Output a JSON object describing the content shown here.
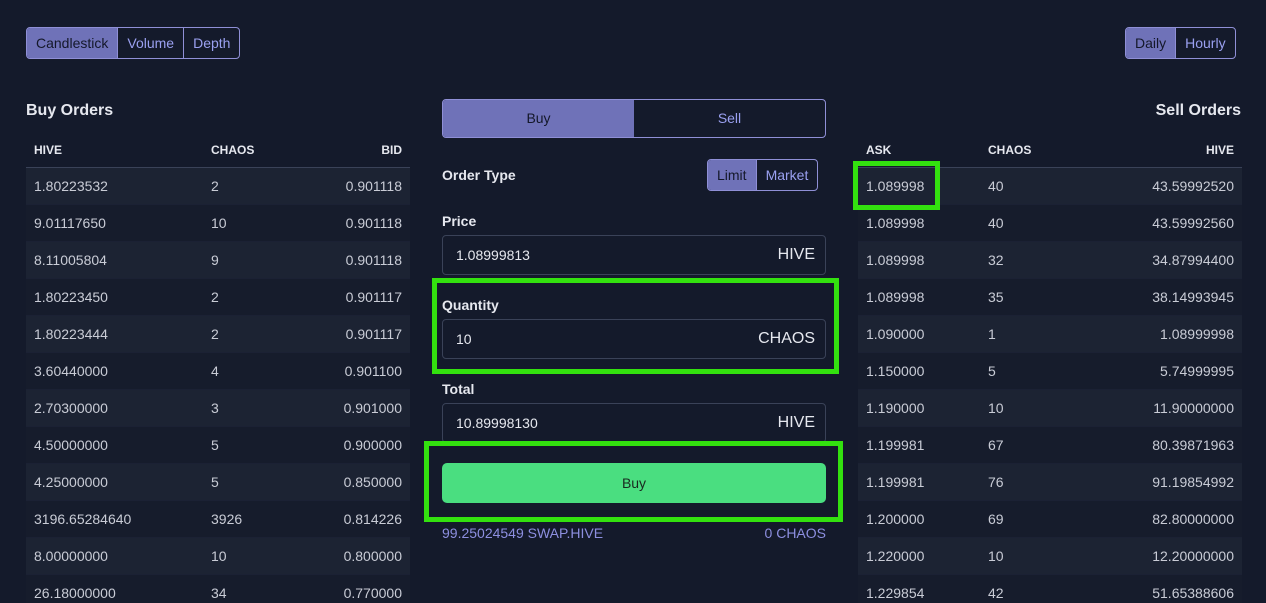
{
  "chart_toggle": {
    "candlestick": "Candlestick",
    "volume": "Volume",
    "depth": "Depth",
    "active": "Candlestick"
  },
  "interval_toggle": {
    "daily": "Daily",
    "hourly": "Hourly",
    "active": "Daily"
  },
  "buy_orders": {
    "title": "Buy Orders",
    "columns": [
      "HIVE",
      "CHAOS",
      "BID"
    ],
    "rows": [
      [
        "1.80223532",
        "2",
        "0.901118"
      ],
      [
        "9.01117650",
        "10",
        "0.901118"
      ],
      [
        "8.11005804",
        "9",
        "0.901118"
      ],
      [
        "1.80223450",
        "2",
        "0.901117"
      ],
      [
        "1.80223444",
        "2",
        "0.901117"
      ],
      [
        "3.60440000",
        "4",
        "0.901100"
      ],
      [
        "2.70300000",
        "3",
        "0.901000"
      ],
      [
        "4.50000000",
        "5",
        "0.900000"
      ],
      [
        "4.25000000",
        "5",
        "0.850000"
      ],
      [
        "3196.65284640",
        "3926",
        "0.814226"
      ],
      [
        "8.00000000",
        "10",
        "0.800000"
      ],
      [
        "26.18000000",
        "34",
        "0.770000"
      ]
    ]
  },
  "sell_orders": {
    "title": "Sell Orders",
    "columns": [
      "ASK",
      "CHAOS",
      "HIVE"
    ],
    "rows": [
      [
        "1.089998",
        "40",
        "43.59992520"
      ],
      [
        "1.089998",
        "40",
        "43.59992560"
      ],
      [
        "1.089998",
        "32",
        "34.87994400"
      ],
      [
        "1.089998",
        "35",
        "38.14993945"
      ],
      [
        "1.090000",
        "1",
        "1.08999998"
      ],
      [
        "1.150000",
        "5",
        "5.74999995"
      ],
      [
        "1.190000",
        "10",
        "11.90000000"
      ],
      [
        "1.199981",
        "67",
        "80.39871963"
      ],
      [
        "1.199981",
        "76",
        "91.19854992"
      ],
      [
        "1.200000",
        "69",
        "82.80000000"
      ],
      [
        "1.220000",
        "10",
        "12.20000000"
      ],
      [
        "1.229854",
        "42",
        "51.65388606"
      ]
    ]
  },
  "order_form": {
    "tabs": {
      "buy": "Buy",
      "sell": "Sell",
      "active": "Buy"
    },
    "order_type_label": "Order Type",
    "order_type": {
      "limit": "Limit",
      "market": "Market",
      "active": "Limit"
    },
    "price": {
      "label": "Price",
      "value": "1.08999813",
      "unit": "HIVE"
    },
    "quantity": {
      "label": "Quantity",
      "value": "10",
      "unit": "CHAOS"
    },
    "total": {
      "label": "Total",
      "value": "10.89998130",
      "unit": "HIVE"
    },
    "submit_label": "Buy",
    "balance_left": "99.25024549 SWAP.HIVE",
    "balance_right": "0 CHAOS"
  },
  "highlight_color": "#33e10f"
}
